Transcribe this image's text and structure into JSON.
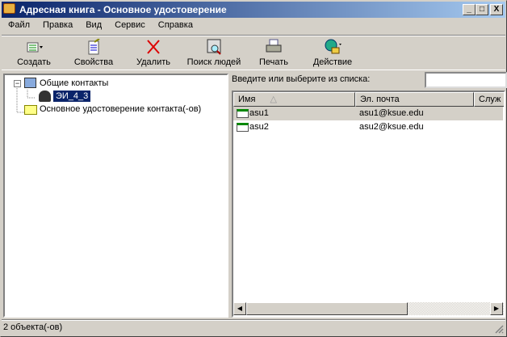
{
  "window": {
    "title": "Адресная книга - Основное удостоверение",
    "minimize": "_",
    "maximize": "□",
    "close": "X"
  },
  "menu": [
    "Файл",
    "Правка",
    "Вид",
    "Сервис",
    "Справка"
  ],
  "toolbar": [
    {
      "label": "Создать",
      "icon": "new-contact-icon"
    },
    {
      "label": "Свойства",
      "icon": "properties-icon"
    },
    {
      "label": "Удалить",
      "icon": "delete-icon"
    },
    {
      "label": "Поиск людей",
      "icon": "find-people-icon"
    },
    {
      "label": "Печать",
      "icon": "print-icon"
    },
    {
      "label": "Действие",
      "icon": "action-icon"
    }
  ],
  "tree": {
    "root": "Общие контакты",
    "child": "ЭИ_4_3",
    "identity": "Основное удостоверение контакта(-ов)",
    "expander": "−"
  },
  "search": {
    "label": "Введите или выберите из списка:",
    "value": ""
  },
  "list": {
    "columns": [
      "Имя",
      "Эл. почта",
      "Служ"
    ],
    "rows": [
      {
        "name": "asu1",
        "email": "asu1@ksue.edu"
      },
      {
        "name": "asu2",
        "email": "asu2@ksue.edu"
      }
    ]
  },
  "scrollbar": {
    "left": "◀",
    "right": "▶"
  },
  "status": "2 объекта(-ов)",
  "colors": {
    "title_start": "#0a246a",
    "title_end": "#a6caf0",
    "selection": "#0a246a"
  }
}
